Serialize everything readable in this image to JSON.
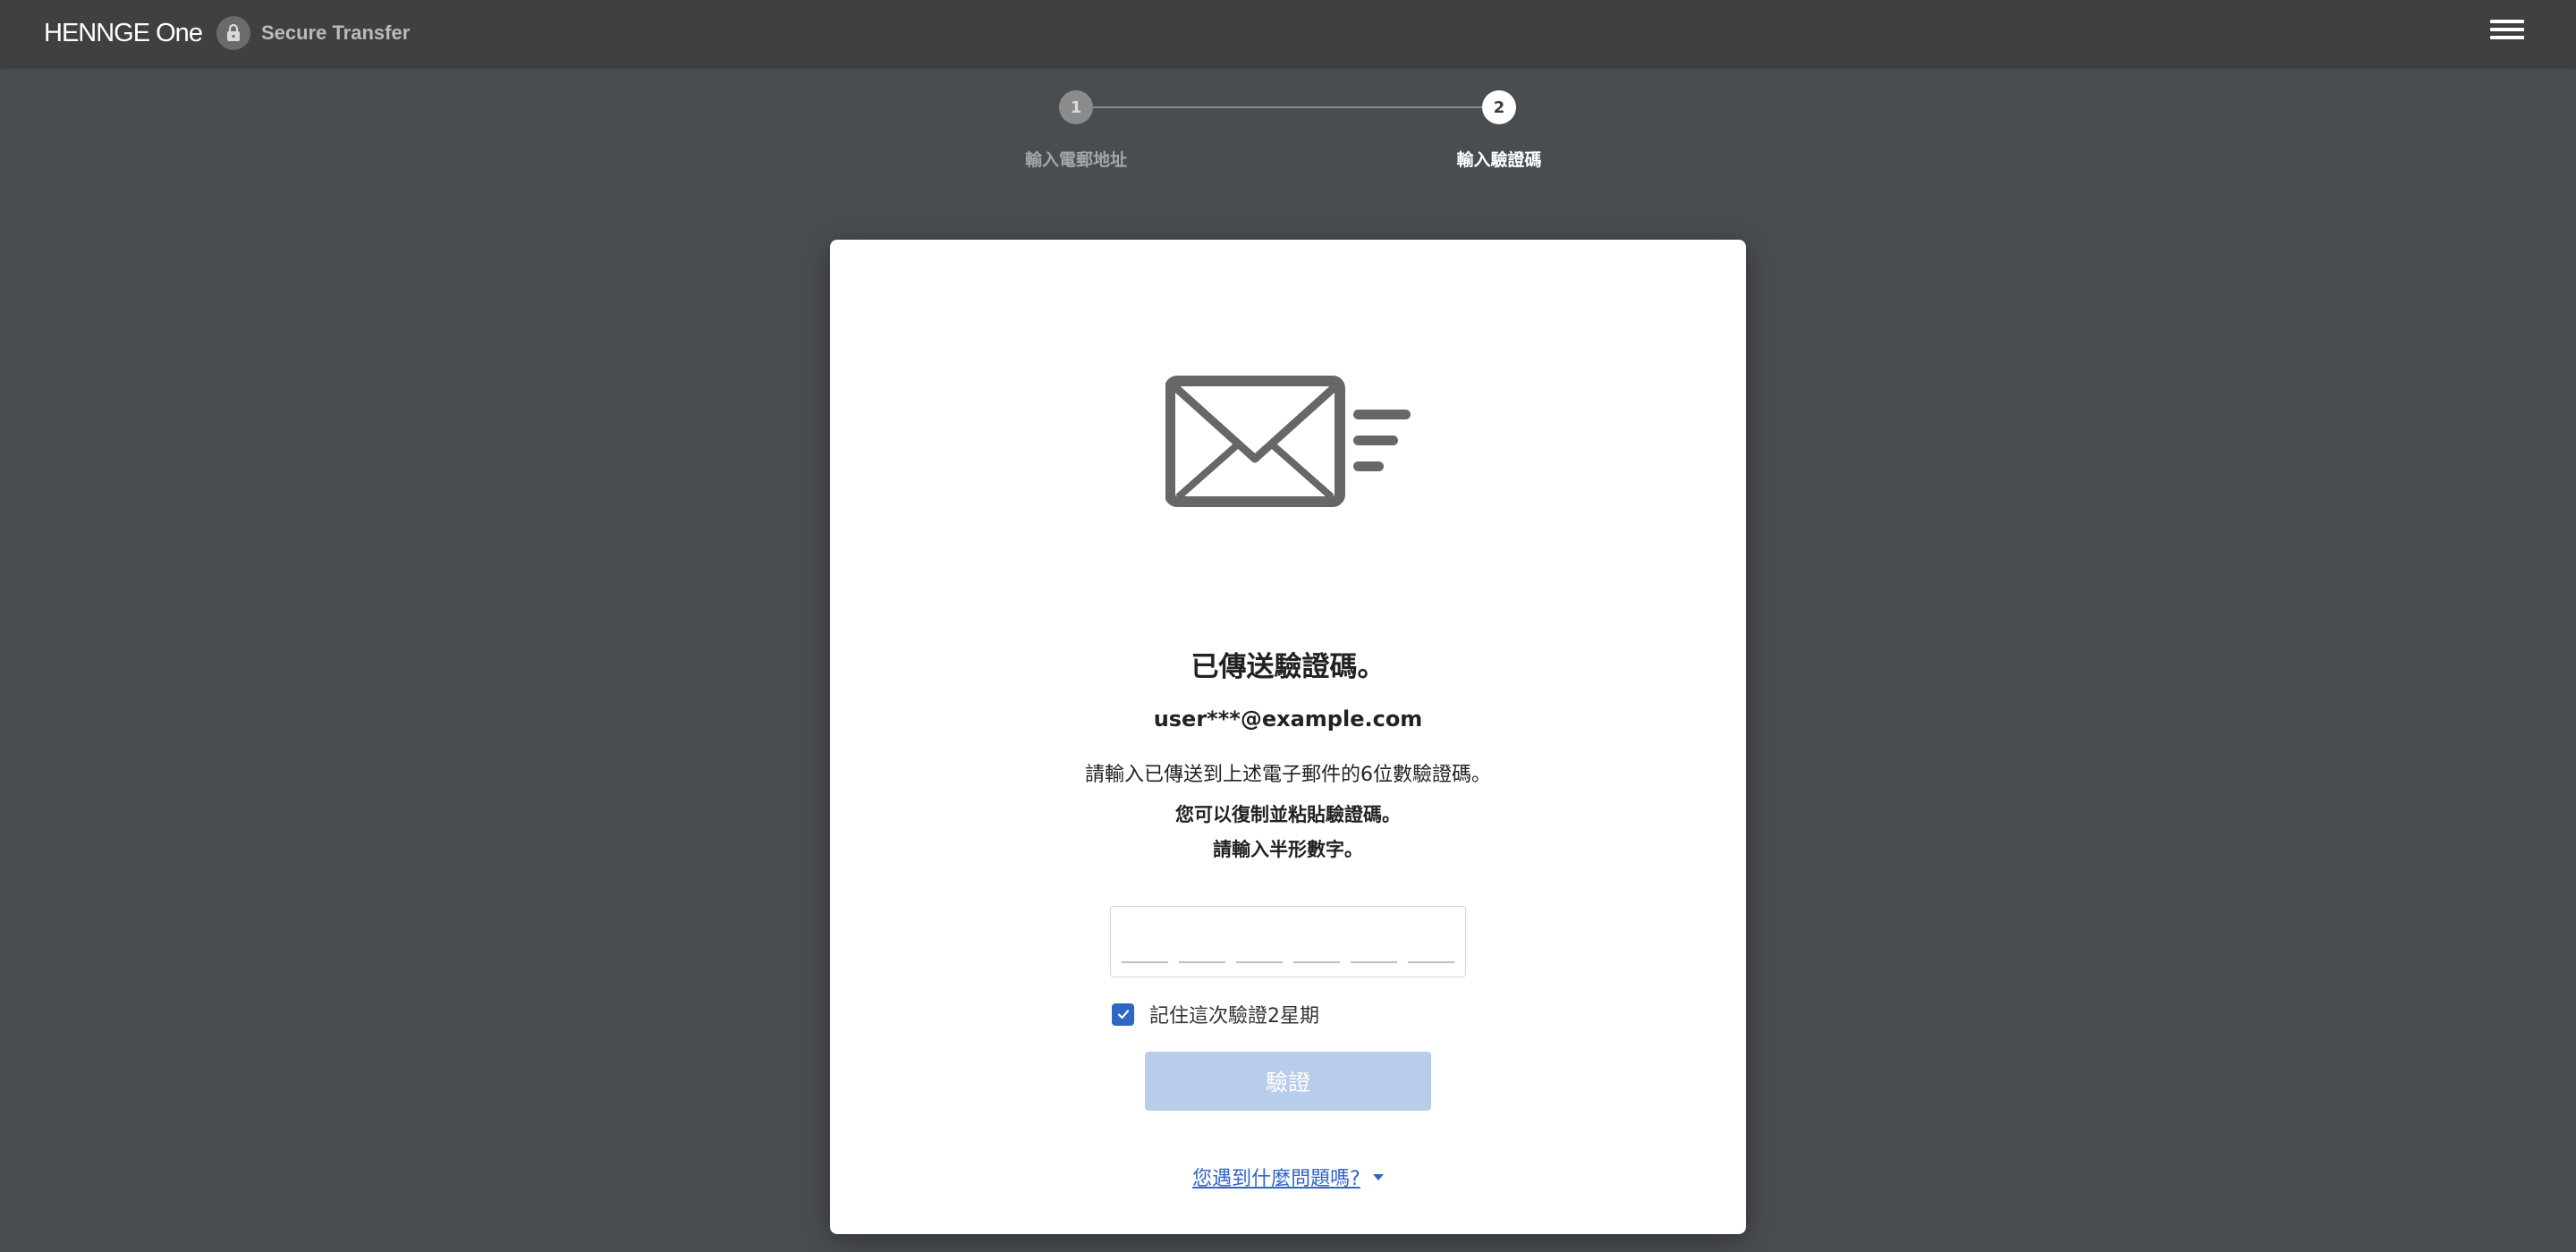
{
  "header": {
    "brand": "HENNGE One",
    "product": "Secure Transfer",
    "icons": {
      "lock": "lock-icon",
      "menu": "hamburger-menu-icon"
    }
  },
  "stepper": {
    "steps": [
      {
        "number": "1",
        "label": "輸入電郵地址",
        "state": "done"
      },
      {
        "number": "2",
        "label": "輸入驗證碼",
        "state": "active"
      }
    ]
  },
  "card": {
    "illustration": "mail-sent-icon",
    "title": "已傳送驗證碼。",
    "email": "user***@example.com",
    "instruction": "請輸入已傳送到上述電子郵件的6位數驗證碼。",
    "note_copy_paste": "您可以復制並粘貼驗證碼。",
    "note_halfwidth": "請輸入半形數字。",
    "code": {
      "digits": [
        "",
        "",
        "",
        "",
        "",
        ""
      ]
    },
    "remember": {
      "label": "記住這次驗證2星期",
      "checked": true
    },
    "verify_button": "驗證",
    "help_link": "您遇到什麼問題嗎?"
  },
  "colors": {
    "background": "#4a4d50",
    "topbar": "#3f4042",
    "accent": "#2f66c6",
    "button_disabled": "#b8cde9"
  }
}
